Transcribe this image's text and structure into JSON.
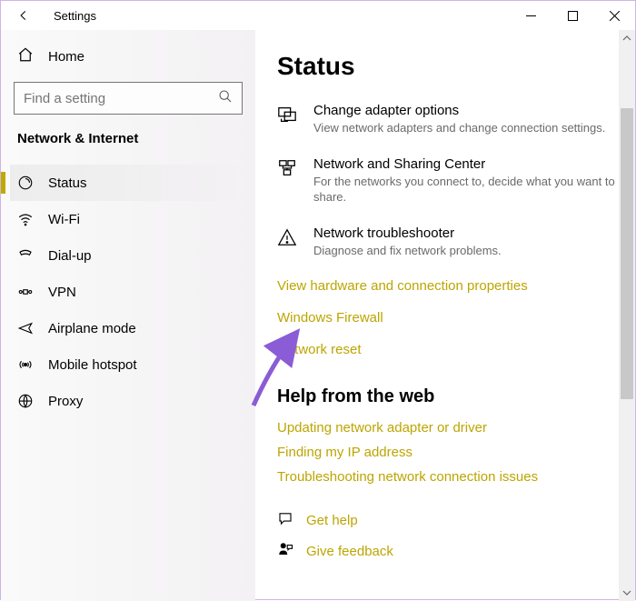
{
  "window": {
    "title": "Settings"
  },
  "sidebar": {
    "home": "Home",
    "search_placeholder": "Find a setting",
    "category": "Network & Internet",
    "items": [
      {
        "label": "Status"
      },
      {
        "label": "Wi-Fi"
      },
      {
        "label": "Dial-up"
      },
      {
        "label": "VPN"
      },
      {
        "label": "Airplane mode"
      },
      {
        "label": "Mobile hotspot"
      },
      {
        "label": "Proxy"
      }
    ]
  },
  "content": {
    "title": "Status",
    "options": [
      {
        "title": "Change adapter options",
        "desc": "View network adapters and change connection settings."
      },
      {
        "title": "Network and Sharing Center",
        "desc": "For the networks you connect to, decide what you want to share."
      },
      {
        "title": "Network troubleshooter",
        "desc": "Diagnose and fix network problems."
      }
    ],
    "links": [
      "View hardware and connection properties",
      "Windows Firewall",
      "Network reset"
    ],
    "help_title": "Help from the web",
    "help_links": [
      "Updating network adapter or driver",
      "Finding my IP address",
      "Troubleshooting network connection issues"
    ],
    "actions": {
      "get_help": "Get help",
      "give_feedback": "Give feedback"
    }
  },
  "colors": {
    "accent": "#bda500"
  }
}
